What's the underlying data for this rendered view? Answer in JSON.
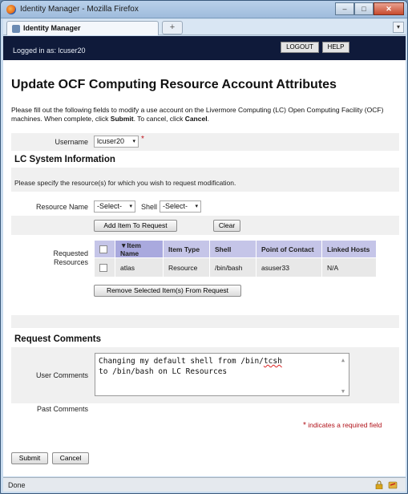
{
  "window": {
    "title": "Identity Manager - Mozilla Firefox",
    "min": "–",
    "max": "□",
    "close": "✕"
  },
  "tabs": {
    "active_label": "Identity Manager",
    "new_tab": "+",
    "scroll": "▾"
  },
  "header": {
    "logged_in": "Logged in as: lcuser20",
    "logout_label": "LOGOUT",
    "help_label": "HELP"
  },
  "page": {
    "title": "Update OCF Computing Resource Account Attributes",
    "intro_part1": "Please fill out the following fields to modify a use account on the Livermore Computing (LC) Open Computing Facility (OCF) machines. When complete, click ",
    "intro_submit": "Submit",
    "intro_part2": ". To cancel, click ",
    "intro_cancel": "Cancel",
    "intro_part3": "."
  },
  "username": {
    "label": "Username",
    "value": "lcuser20",
    "required_mark": "*"
  },
  "lc_system": {
    "heading": "LC System Information",
    "note": "Please specify the resource(s) for which you wish to request modification.",
    "resource_label": "Resource Name",
    "resource_value": "-Select-",
    "shell_label": "Shell",
    "shell_value": "-Select-",
    "add_button": "Add Item To Request",
    "clear_button": "Clear",
    "requested_label_line1": "Requested",
    "requested_label_line2": "Resources",
    "table": {
      "headers": [
        "",
        "▼Item Name",
        "Item Type",
        "Shell",
        "Point of Contact",
        "Linked Hosts"
      ],
      "rows": [
        [
          "",
          "atlas",
          "Resource",
          "/bin/bash",
          "asuser33",
          "N/A"
        ]
      ]
    },
    "remove_button": "Remove Selected Item(s) From Request"
  },
  "comments": {
    "heading": "Request Comments",
    "user_label": "User Comments",
    "user_text_line1_prefix": "Changing my default shell from /bin/",
    "user_text_line1_misspelled": "tcsh",
    "user_text_line2": "to /bin/bash on LC Resources",
    "past_label": "Past Comments"
  },
  "required_note": {
    "star": "*",
    "text": " indicates a required field"
  },
  "actions": {
    "submit": "Submit",
    "cancel": "Cancel"
  },
  "status": {
    "text": "Done"
  },
  "caret": "▾"
}
